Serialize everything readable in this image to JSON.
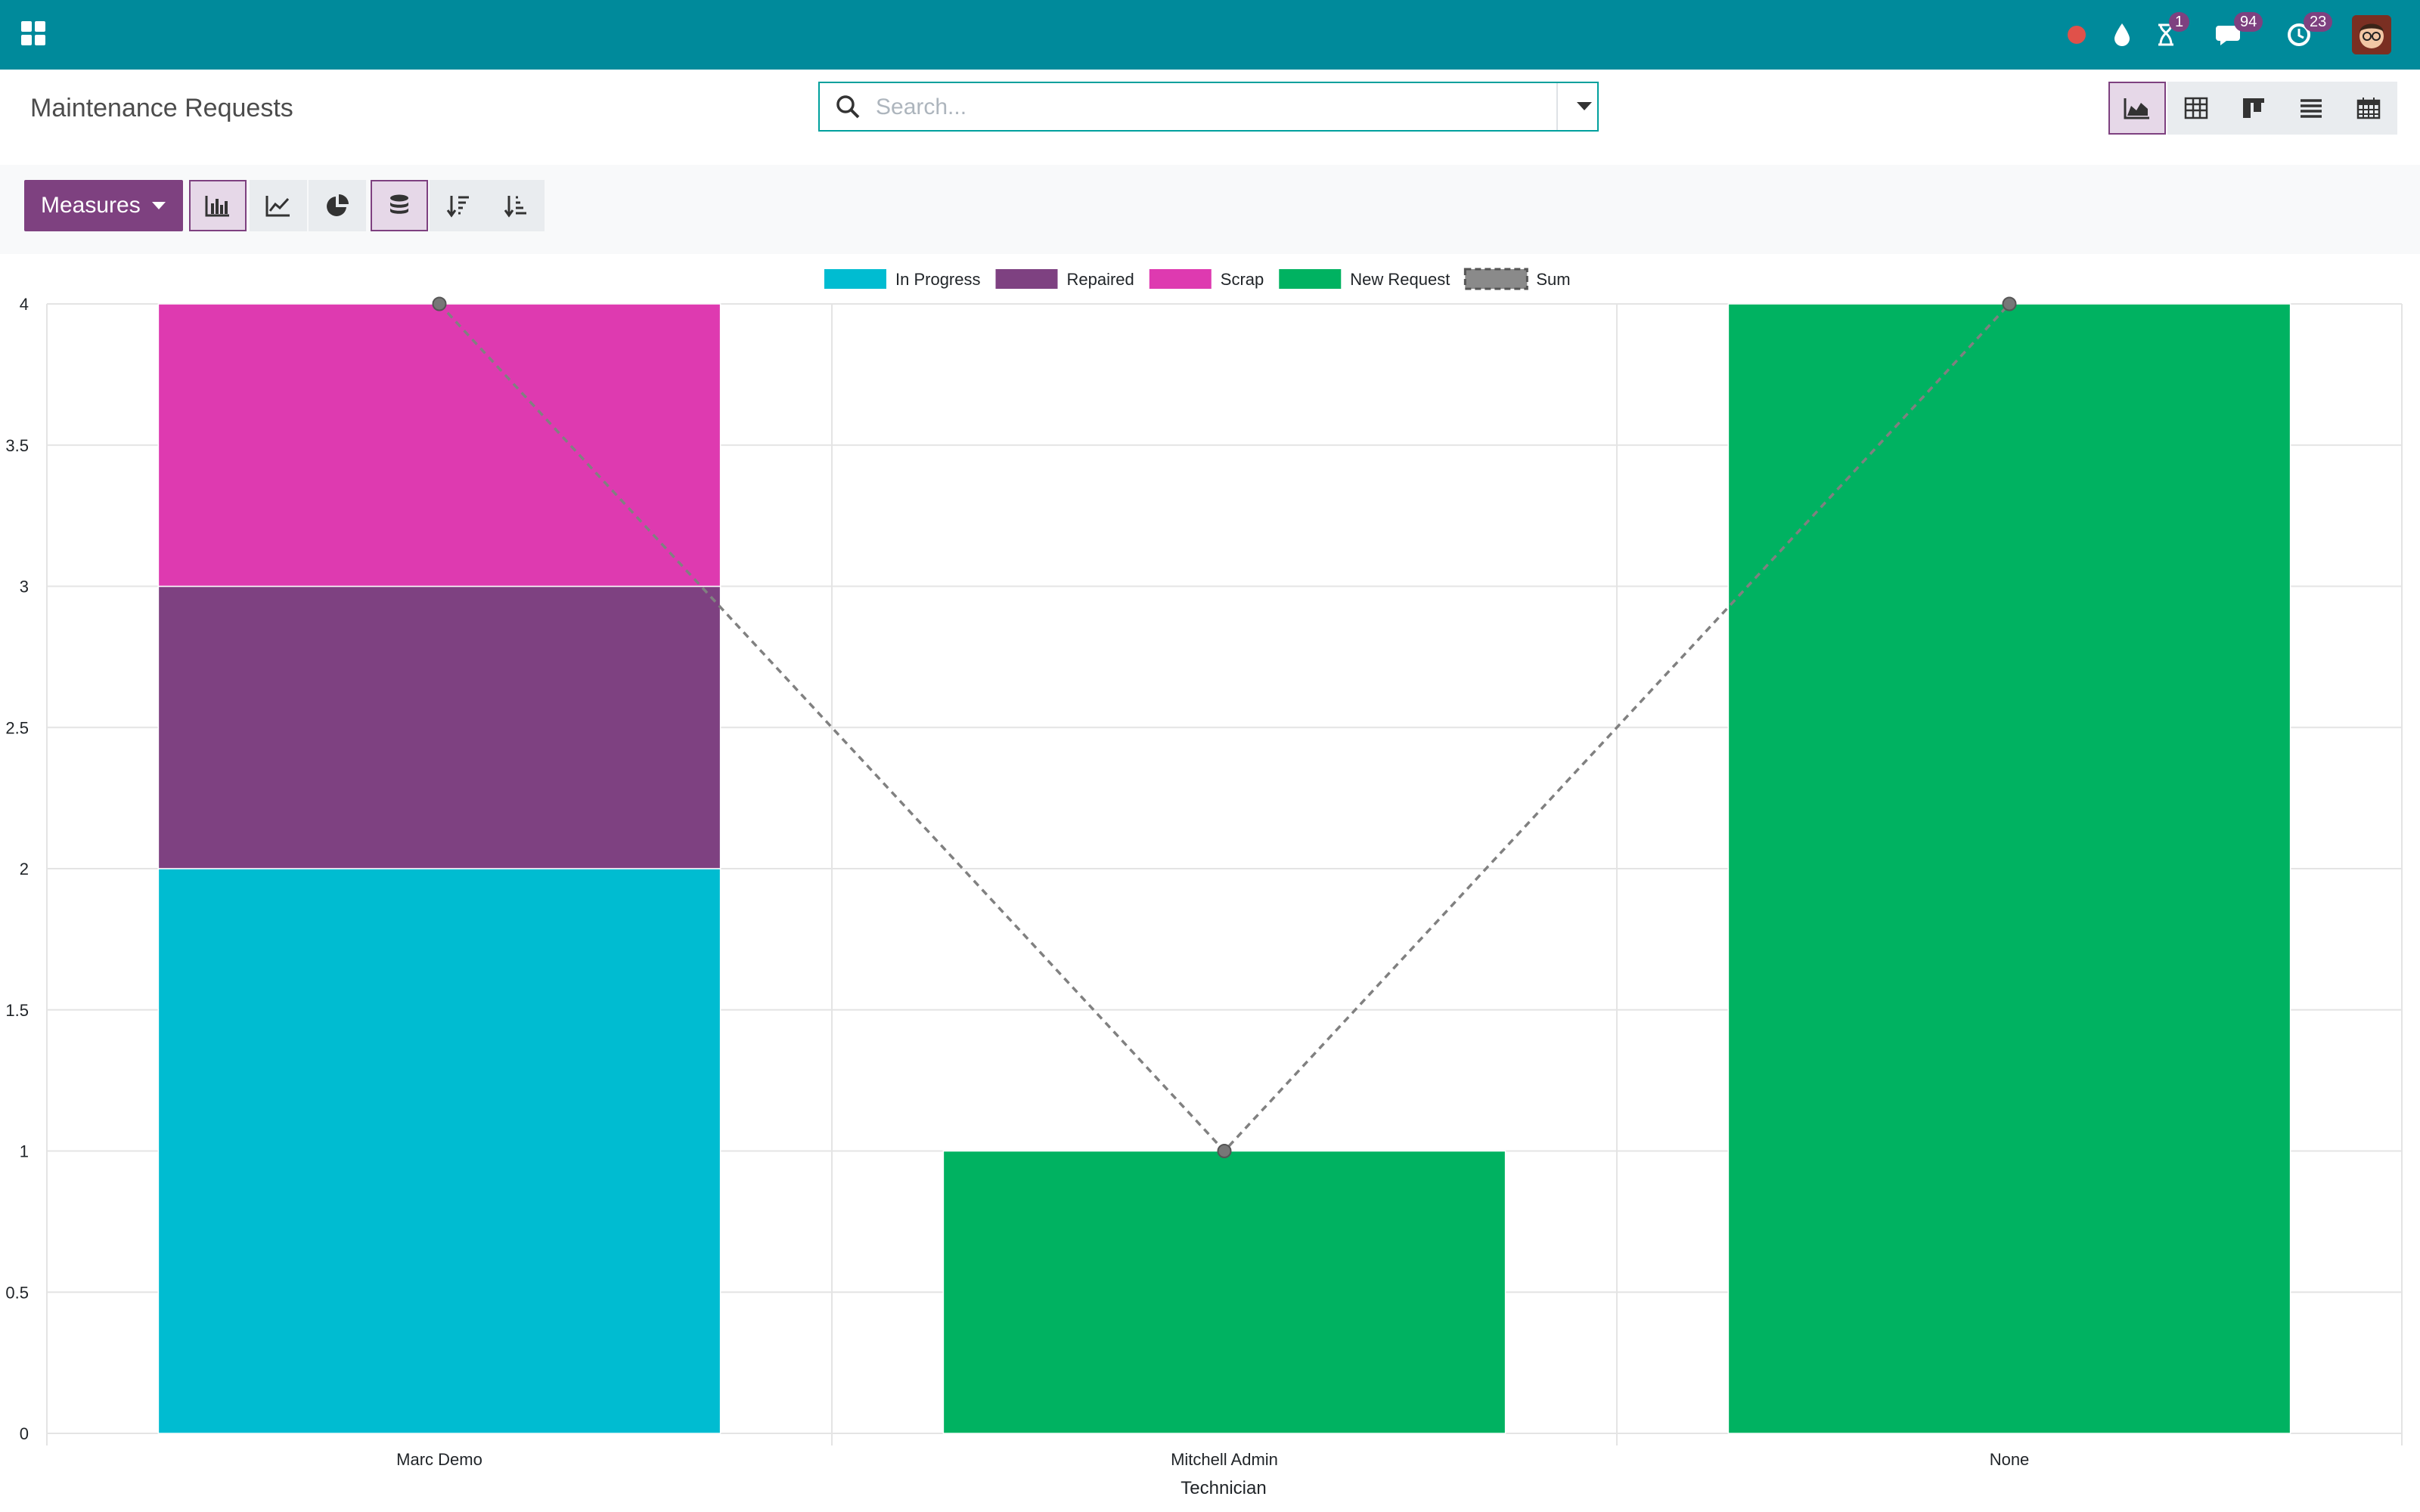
{
  "app": {
    "title": "Maintenance Requests"
  },
  "search": {
    "placeholder": "Search..."
  },
  "navbar": {
    "activity_badge": "1",
    "messages_badge": "94",
    "updates_badge": "23"
  },
  "toolbar": {
    "measures_label": "Measures"
  },
  "colors": {
    "navbar": "#008a9b",
    "brand": "#7e4180",
    "in_progress": "#00bcd1",
    "repaired": "#7e4181",
    "scrap": "#de3ab0",
    "new_request": "#00b261",
    "sum": "#808080"
  },
  "chart_data": {
    "type": "bar",
    "stacked": true,
    "categories": [
      "Marc Demo",
      "Mitchell Admin",
      "None"
    ],
    "series": [
      {
        "name": "In Progress",
        "values": [
          2,
          0,
          0
        ],
        "color": "#00bcd1"
      },
      {
        "name": "Repaired",
        "values": [
          1,
          0,
          0
        ],
        "color": "#7e4181"
      },
      {
        "name": "Scrap",
        "values": [
          1,
          0,
          0
        ],
        "color": "#de3ab0"
      },
      {
        "name": "New Request",
        "values": [
          0,
          1,
          4
        ],
        "color": "#00b261"
      }
    ],
    "line_series": {
      "name": "Sum",
      "values": [
        4,
        1,
        4
      ],
      "color": "#808080",
      "dashed": true
    },
    "xlabel": "Technician",
    "ylabel": "",
    "ylim": [
      0,
      4
    ],
    "yticks": [
      "0",
      "0.5",
      "1",
      "1.5",
      "2",
      "2.5",
      "3",
      "3.5",
      "4"
    ],
    "grid": true,
    "legend": "top-center"
  }
}
